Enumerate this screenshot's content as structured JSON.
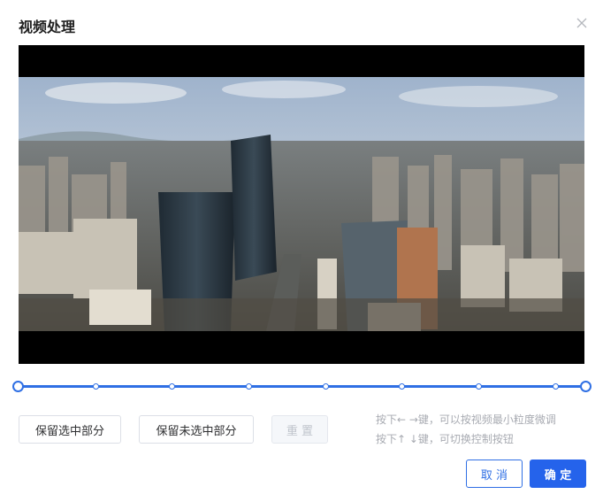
{
  "dialog": {
    "title": "视频处理",
    "close_icon": "close-icon"
  },
  "player": {
    "frame_icon": "aerial-city-video-frame"
  },
  "slider": {
    "start": 0.0,
    "end": 1.0,
    "step_marks": [
      0.0,
      0.133,
      0.267,
      0.4,
      0.533,
      0.667,
      0.8,
      0.933,
      1.0
    ],
    "color": "#2f6fe4"
  },
  "actions": {
    "keep_selected": "保留选中部分",
    "keep_unselected": "保留未选中部分",
    "reset": "重 置"
  },
  "hints": {
    "line1": "按下← →键，可以按视频最小粒度微调",
    "line2": "按下↑ ↓键，可切换控制按钮"
  },
  "footer": {
    "cancel": "取 消",
    "confirm": "确 定",
    "primary_color": "#2563eb"
  }
}
